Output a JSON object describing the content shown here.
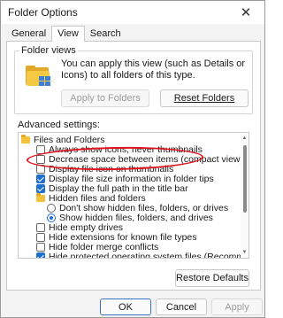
{
  "window": {
    "title": "Folder Options"
  },
  "tabs": [
    "General",
    "View",
    "Search"
  ],
  "folder_views": {
    "title": "Folder views",
    "description": "You can apply this view (such as Details or Icons) to all folders of this type.",
    "apply_button": "Apply to Folders",
    "reset_button": "Reset Folders"
  },
  "advanced": {
    "label": "Advanced settings:",
    "items": [
      {
        "label": "Files and Folders",
        "type": "folder"
      },
      {
        "label": "Always show icons, never thumbnails",
        "type": "checkbox",
        "checked": false
      },
      {
        "label": "Decrease space between items (compact view)",
        "type": "checkbox",
        "checked": false
      },
      {
        "label": "Display file icon on thumbnails",
        "type": "checkbox",
        "checked": false
      },
      {
        "label": "Display file size information in folder tips",
        "type": "checkbox",
        "checked": true
      },
      {
        "label": "Display the full path in the title bar",
        "type": "checkbox",
        "checked": true
      },
      {
        "label": "Hidden files and folders",
        "type": "folder"
      },
      {
        "label": "Don't show hidden files, folders, or drives",
        "type": "radio",
        "checked": false
      },
      {
        "label": "Show hidden files, folders, and drives",
        "type": "radio",
        "checked": true
      },
      {
        "label": "Hide empty drives",
        "type": "checkbox",
        "checked": false
      },
      {
        "label": "Hide extensions for known file types",
        "type": "checkbox",
        "checked": false
      },
      {
        "label": "Hide folder merge conflicts",
        "type": "checkbox",
        "checked": false
      },
      {
        "label": "Hide protected operating system files (Recommended)",
        "type": "checkbox",
        "checked": true
      }
    ],
    "restore_button": "Restore Defaults"
  },
  "footer": {
    "ok": "OK",
    "cancel": "Cancel",
    "apply": "Apply"
  },
  "colors": {
    "accent": "#1f6fcf",
    "annotation": "#e0141e",
    "folder": "#f3c23d"
  }
}
